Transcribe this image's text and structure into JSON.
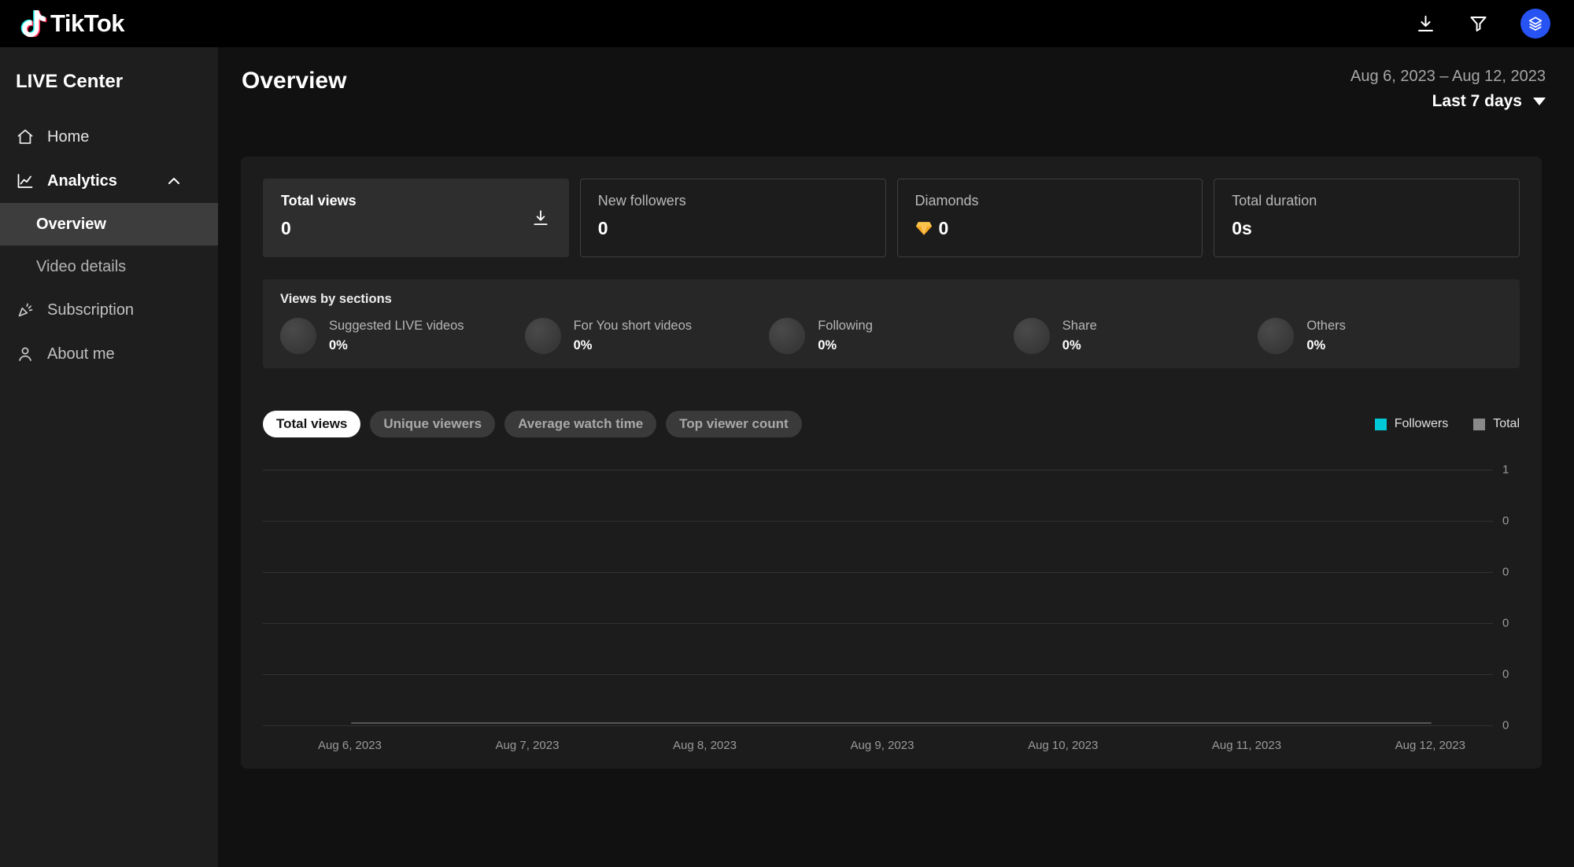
{
  "topbar": {
    "logo_text": "TikTok"
  },
  "sidebar": {
    "title": "LIVE Center",
    "items": [
      {
        "label": "Home",
        "icon": "home-icon"
      },
      {
        "label": "Analytics",
        "icon": "analytics-icon"
      },
      {
        "label": "Overview"
      },
      {
        "label": "Video details"
      },
      {
        "label": "Subscription",
        "icon": "subscription-icon"
      },
      {
        "label": "About me",
        "icon": "person-icon"
      }
    ]
  },
  "header": {
    "title": "Overview",
    "date_range": "Aug 6, 2023 – Aug 12, 2023",
    "period_label": "Last 7 days"
  },
  "stats": [
    {
      "label": "Total views",
      "value": "0"
    },
    {
      "label": "New followers",
      "value": "0"
    },
    {
      "label": "Diamonds",
      "value": "0",
      "icon": "diamond-icon"
    },
    {
      "label": "Total duration",
      "value": "0s"
    }
  ],
  "views_by_sections": {
    "title": "Views by sections",
    "items": [
      {
        "label": "Suggested LIVE videos",
        "value": "0%"
      },
      {
        "label": "For You short videos",
        "value": "0%"
      },
      {
        "label": "Following",
        "value": "0%"
      },
      {
        "label": "Share",
        "value": "0%"
      },
      {
        "label": "Others",
        "value": "0%"
      }
    ]
  },
  "tabs": [
    {
      "label": "Total views",
      "active": true
    },
    {
      "label": "Unique viewers",
      "active": false
    },
    {
      "label": "Average watch time",
      "active": false
    },
    {
      "label": "Top viewer count",
      "active": false
    }
  ],
  "legend": [
    {
      "label": "Followers",
      "color": "#00c8d6"
    },
    {
      "label": "Total",
      "color": "#8a8a8a"
    }
  ],
  "chart_data": {
    "type": "line",
    "title": "",
    "x": [
      "Aug 6, 2023",
      "Aug 7, 2023",
      "Aug 8, 2023",
      "Aug 9, 2023",
      "Aug 10, 2023",
      "Aug 11, 2023",
      "Aug 12, 2023"
    ],
    "series": [
      {
        "name": "Followers",
        "values": [
          0,
          0,
          0,
          0,
          0,
          0,
          0
        ],
        "color": "#00c8d6"
      },
      {
        "name": "Total",
        "values": [
          0,
          0,
          0,
          0,
          0,
          0,
          0
        ],
        "color": "#8a8a8a"
      }
    ],
    "y_ticks_top_to_bottom": [
      "1",
      "0",
      "0",
      "0",
      "0",
      "0"
    ],
    "ylim": [
      0,
      1
    ],
    "grid": true,
    "legend_position": "top-right"
  },
  "colors": {
    "accent_cyan": "#00c8d6",
    "avatar_blue": "#2653f1",
    "diamond_orange": "#f7a823"
  }
}
